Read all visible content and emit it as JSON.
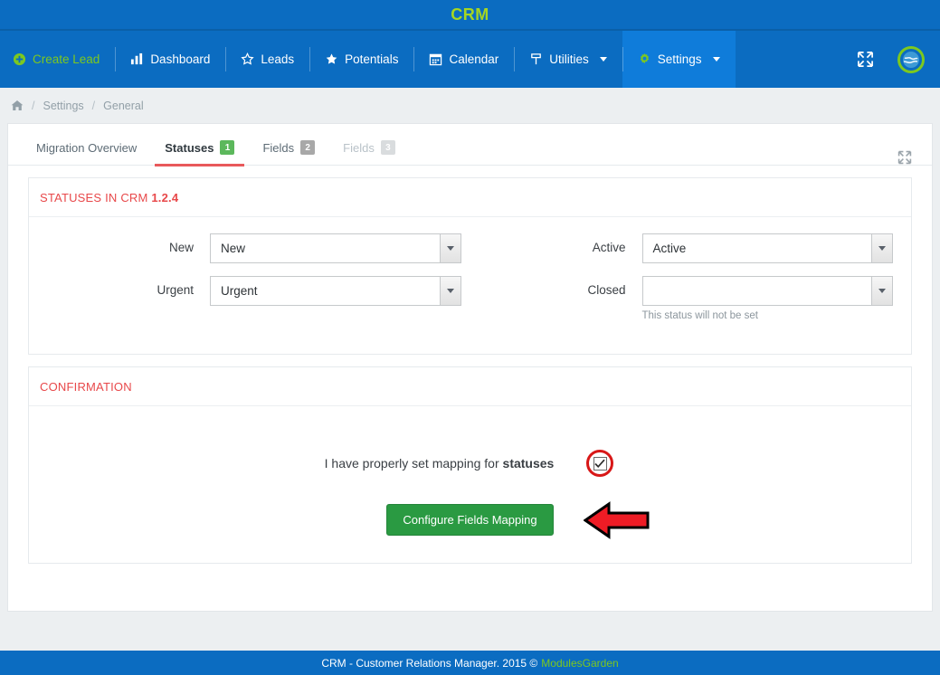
{
  "brand": {
    "title": "CRM"
  },
  "nav": {
    "items": [
      {
        "label": "Create Lead",
        "icon": "plus-circle-icon",
        "style": "create"
      },
      {
        "label": "Dashboard",
        "icon": "chart-bar-icon",
        "style": ""
      },
      {
        "label": "Leads",
        "icon": "star-outline-icon",
        "style": ""
      },
      {
        "label": "Potentials",
        "icon": "star-filled-icon",
        "style": ""
      },
      {
        "label": "Calendar",
        "icon": "calendar-icon",
        "style": ""
      },
      {
        "label": "Utilities",
        "icon": "wrench-icon",
        "style": "",
        "caret": true
      },
      {
        "label": "Settings",
        "icon": "gear-icon",
        "style": "active",
        "caret": true
      }
    ],
    "expand_icon": "expand-arrows-icon",
    "avatar_icon": "globe-avatar-icon"
  },
  "breadcrumb": {
    "home_icon": "home-icon",
    "separator": "/",
    "items": [
      "Settings",
      "General"
    ]
  },
  "tabs": {
    "expand_icon": "expand-arrows-icon",
    "items": [
      {
        "label": "Migration Overview",
        "badge": "",
        "state": ""
      },
      {
        "label": "Statuses",
        "badge": "1",
        "badge_color": "green",
        "state": "active"
      },
      {
        "label": "Fields",
        "badge": "2",
        "badge_color": "gray",
        "state": ""
      },
      {
        "label": "Fields",
        "badge": "3",
        "badge_color": "light",
        "state": "disabled"
      }
    ]
  },
  "statuses_panel": {
    "heading_text": "STATUSES IN CRM",
    "heading_version": "1.2.4",
    "fields": [
      {
        "label": "New",
        "value": "New",
        "help": ""
      },
      {
        "label": "Urgent",
        "value": "Urgent",
        "help": ""
      },
      {
        "label": "Active",
        "value": "Active",
        "help": ""
      },
      {
        "label": "Closed",
        "value": "",
        "help": "This status will not be set"
      }
    ]
  },
  "confirmation_panel": {
    "heading": "CONFIRMATION",
    "text_prefix": "I have properly set mapping for ",
    "text_bold": "statuses",
    "checkbox_checked": true,
    "button_label": "Configure Fields Mapping"
  },
  "footer": {
    "text": "CRM - Customer Relations Manager. 2015 ©",
    "company": "ModulesGarden"
  },
  "colors": {
    "brand_blue": "#0b6cc1",
    "brand_green": "#7dc81f",
    "accent_red": "#e8484a",
    "button_green": "#2a9a42",
    "annotation_red": "#d81717"
  }
}
